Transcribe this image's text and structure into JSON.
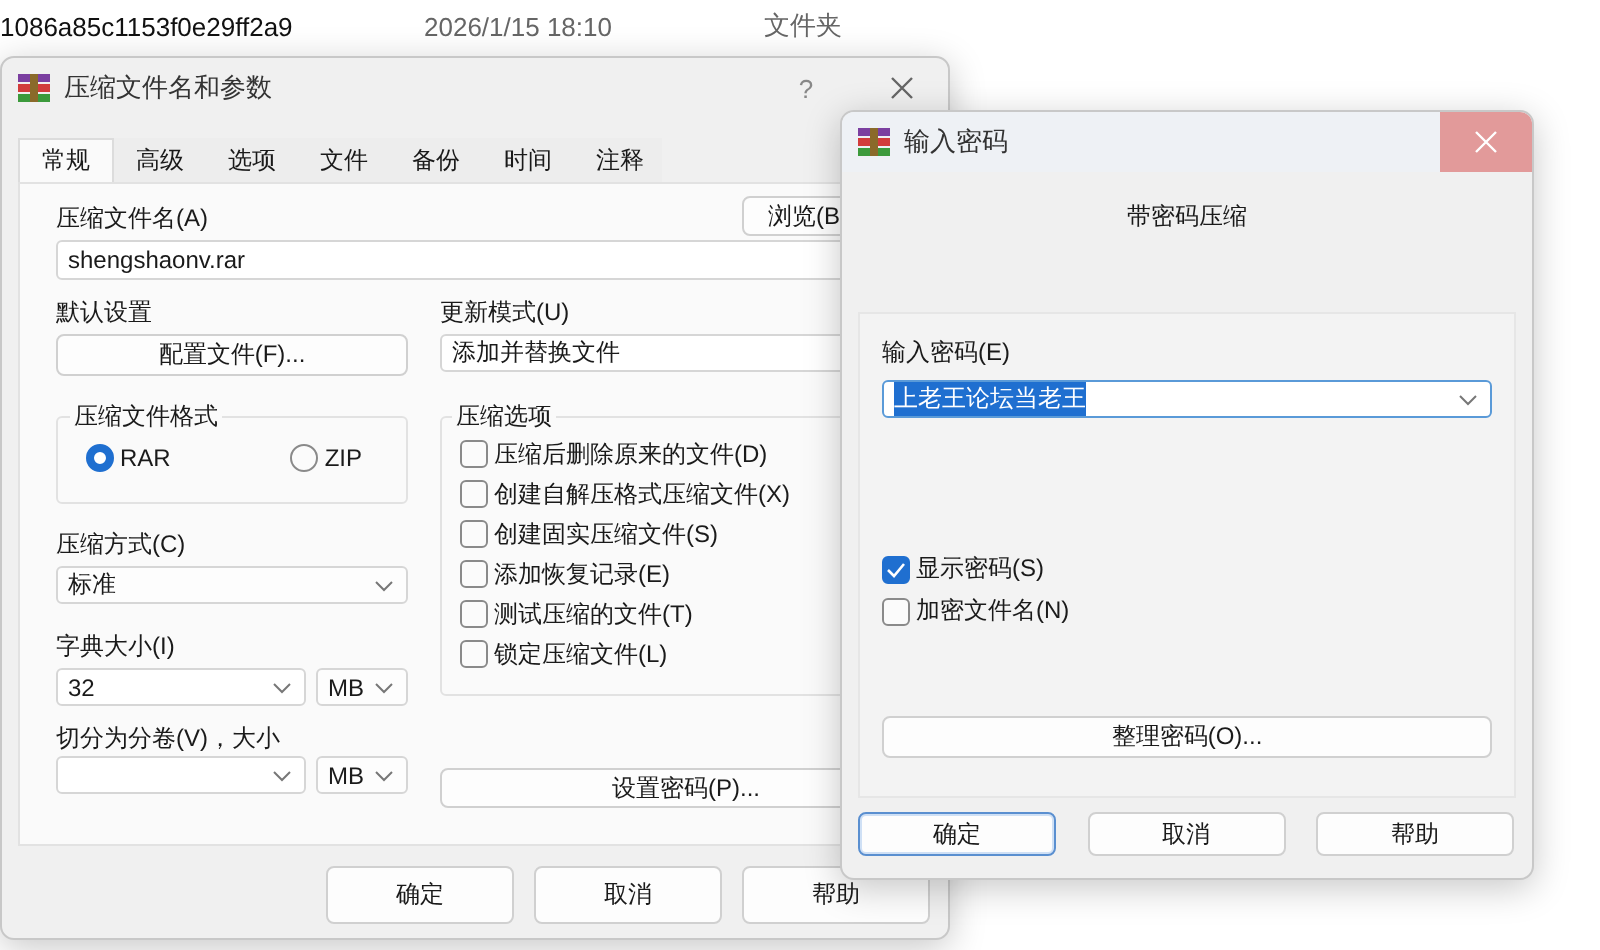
{
  "background_row": {
    "name": "1086a85c1153f0e29ff2a9",
    "date": "2026/1/15 18:10",
    "type": "文件夹"
  },
  "main_dialog": {
    "title": "压缩文件名和参数",
    "help_glyph": "?",
    "tabs": [
      {
        "label": "常规",
        "selected": true
      },
      {
        "label": "高级",
        "selected": false
      },
      {
        "label": "选项",
        "selected": false
      },
      {
        "label": "文件",
        "selected": false
      },
      {
        "label": "备份",
        "selected": false
      },
      {
        "label": "时间",
        "selected": false
      },
      {
        "label": "注释",
        "selected": false
      }
    ],
    "archive_name": {
      "label": "压缩文件名(A)",
      "value": "shengshaonv.rar"
    },
    "browse_button": "浏览(B",
    "profiles": {
      "label": "默认设置",
      "button": "配置文件(F)..."
    },
    "update_mode": {
      "label": "更新模式(U)",
      "value": "添加并替换文件"
    },
    "format": {
      "label": "压缩文件格式",
      "options": [
        {
          "label": "RAR",
          "selected": true
        },
        {
          "label": "ZIP",
          "selected": false
        }
      ]
    },
    "method": {
      "label": "压缩方式(C)",
      "value": "标准"
    },
    "dictionary": {
      "label": "字典大小(I)",
      "value": "32",
      "unit": "MB"
    },
    "split": {
      "label": "切分为分卷(V)，大小",
      "unit": "MB"
    },
    "options": {
      "label": "压缩选项",
      "items": [
        {
          "label": "压缩后删除原来的文件(D)",
          "checked": false
        },
        {
          "label": "创建自解压格式压缩文件(X)",
          "checked": false
        },
        {
          "label": "创建固实压缩文件(S)",
          "checked": false
        },
        {
          "label": "添加恢复记录(E)",
          "checked": false
        },
        {
          "label": "测试压缩的文件(T)",
          "checked": false
        },
        {
          "label": "锁定压缩文件(L)",
          "checked": false
        }
      ]
    },
    "password_button": "设置密码(P)...",
    "buttons": [
      "确定",
      "取消",
      "帮助"
    ]
  },
  "password_dialog": {
    "title": "输入密码",
    "close_hovered": true,
    "subtitle": "带密码压缩",
    "password": {
      "label": "输入密码(E)",
      "value": "上老王论坛当老王",
      "highlighted": true
    },
    "checks": [
      {
        "label": "显示密码(S)",
        "checked": true
      },
      {
        "label": "加密文件名(N)",
        "checked": false
      }
    ],
    "organize_button": "整理密码(O)...",
    "buttons": [
      {
        "label": "确定",
        "focused": true
      },
      {
        "label": "取消",
        "focused": false
      },
      {
        "label": "帮助",
        "focused": false
      }
    ]
  }
}
